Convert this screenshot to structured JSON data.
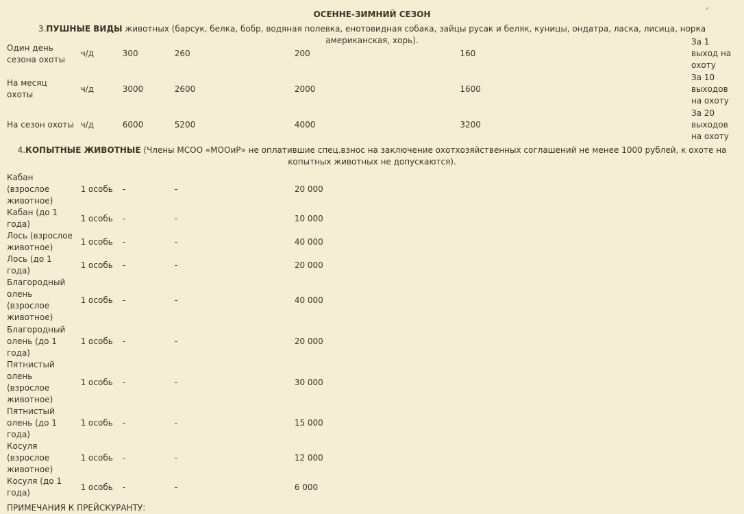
{
  "top_mark": "’",
  "season_title": "ОСЕННЕ-ЗИМНИЙ СЕЗОН",
  "section3": {
    "number": "3.",
    "bold": "ПУШНЫЕ ВИДЫ",
    "rest": " животных (барсук, белка, бобр, водяная полевка, енотовидная собака, зайцы русак и беляк, куницы, ондатра, ласка, лисица, норка американская, хорь)."
  },
  "fur_rows": [
    {
      "name": "Один день сезона охоты",
      "unit": "ч/д",
      "v1": "300",
      "v2": "260",
      "v3": "200",
      "v4": "160",
      "note": "За 1 выход на охоту"
    },
    {
      "name": "На месяц охоты",
      "unit": "ч/д",
      "v1": "3000",
      "v2": "2600",
      "v3": "2000",
      "v4": "1600",
      "note": "За 10 выходов на охоту"
    },
    {
      "name": "На сезон охоты",
      "unit": "ч/д",
      "v1": "6000",
      "v2": "5200",
      "v3": "4000",
      "v4": "3200",
      "note": "За 20 выходов на охоту"
    }
  ],
  "section4": {
    "number": "4.",
    "bold": "КОПЫТНЫЕ ЖИВОТНЫЕ",
    "rest": " (Члены МСОО «МООиР» не оплатившие спец.взнос на заключение охотхозяйственных соглашений не менее 1000 рублей, к охоте на копытных животных не допускаются)."
  },
  "ungulate_rows": [
    {
      "name": "Кабан (взрослое животное)",
      "unit": "1 особь",
      "v1": "-",
      "v2": "-",
      "v3": "20 000"
    },
    {
      "name": "Кабан (до 1 года)",
      "unit": "1 особь",
      "v1": "-",
      "v2": "-",
      "v3": "10 000"
    },
    {
      "name": "Лось (взрослое животное)",
      "unit": "1 особь",
      "v1": "-",
      "v2": "-",
      "v3": "40 000"
    },
    {
      "name": "Лось (до 1 года)",
      "unit": "1 особь",
      "v1": "-",
      "v2": "-",
      "v3": "20 000"
    },
    {
      "name": "Благородный олень (взрослое животное)",
      "unit": "1 особь",
      "v1": "-",
      "v2": "-",
      "v3": "40 000"
    },
    {
      "name": "Благородный олень (до 1 года)",
      "unit": "1 особь",
      "v1": "-",
      "v2": "-",
      "v3": "20 000"
    },
    {
      "name": "Пятнистый олень (взрослое животное)",
      "unit": "1 особь",
      "v1": "-",
      "v2": "-",
      "v3": "30 000"
    },
    {
      "name": "Пятнистый олень (до 1 года)",
      "unit": "1 особь",
      "v1": "-",
      "v2": "-",
      "v3": "15 000"
    },
    {
      "name": "Косуля (взрослое животное)",
      "unit": "1 особь",
      "v1": "-",
      "v2": "-",
      "v3": "12 000"
    },
    {
      "name": "Косуля (до 1 года)",
      "unit": "1 особь",
      "v1": "-",
      "v2": "-",
      "v3": "6 000"
    }
  ],
  "notes_title": "ПРИМЕЧАНИЯ К ПРЕЙСКУРАНТУ:"
}
